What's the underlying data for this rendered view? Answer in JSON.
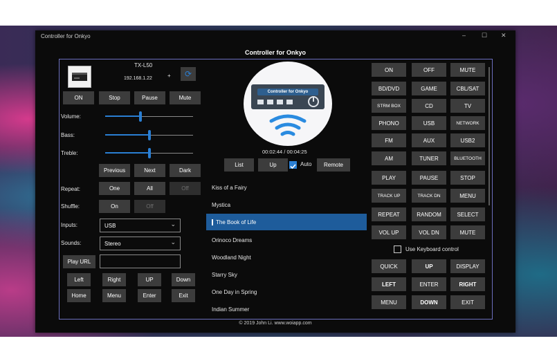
{
  "window": {
    "title": "Controller for Onkyo",
    "minimize": "–",
    "maximize": "☐",
    "close": "✕"
  },
  "app": {
    "title": "Controller for Onkyo",
    "footer": "© 2019 John Li. www.woiapp.com"
  },
  "device": {
    "model": "TX-L50",
    "ip": "192.168.1.22",
    "plus": "+"
  },
  "left": {
    "row1": [
      "ON",
      "Stop",
      "Pause",
      "Mute"
    ],
    "volume_label": "Volume:",
    "volume": 0.4,
    "bass_label": "Bass:",
    "bass": 0.5,
    "treble_label": "Treble:",
    "treble": 0.5,
    "nav": [
      "Previous",
      "Next",
      "Dark"
    ],
    "repeat_label": "Repeat:",
    "repeat": [
      "One",
      "All",
      "Off"
    ],
    "shuffle_label": "Shuffle:",
    "shuffle": [
      "On",
      "Off"
    ],
    "inputs_label": "Inputs:",
    "inputs_value": "USB",
    "sounds_label": "Sounds:",
    "sounds_value": "Stereo",
    "play_url": "Play URL",
    "url_value": "",
    "dir_row1": [
      "Left",
      "Right",
      "UP",
      "Down"
    ],
    "dir_row2": [
      "Home",
      "Menu",
      "Enter",
      "Exit"
    ]
  },
  "center": {
    "logo_text": "Controller for Onkyo",
    "time": "00:02:44 / 00:04:25",
    "list_btn": "List",
    "up_btn": "Up",
    "auto_label": "Auto",
    "remote_btn": "Remote",
    "songs": [
      "Kiss of a Fairy",
      "Mystica",
      "The Book of Life",
      "Orinoco Dreams",
      "Woodland Night",
      "Starry Sky",
      "One Day in Spring",
      "Indian Summer"
    ],
    "selected_song": "The Book of Life"
  },
  "right": {
    "rows": [
      [
        "ON",
        "OFF",
        "MUTE"
      ],
      [
        "BD/DVD",
        "GAME",
        "CBL/SAT"
      ],
      [
        "STRM BOX",
        "CD",
        "TV"
      ],
      [
        "PHONO",
        "USB",
        "NETWORK"
      ],
      [
        "FM",
        "AUX",
        "USB2"
      ],
      [
        "AM",
        "TUNER",
        "BLUETOOTH"
      ],
      [
        "PLAY",
        "PAUSE",
        "STOP"
      ],
      [
        "TRACK UP",
        "TRACK DN",
        "MENU"
      ],
      [
        "REPEAT",
        "RANDOM",
        "SELECT"
      ],
      [
        "VOL UP",
        "VOL DN",
        "MUTE"
      ]
    ],
    "keyboard_label": "Use Keyboard control",
    "nav_rows": [
      [
        "QUICK",
        "UP",
        "DISPLAY"
      ],
      [
        "LEFT",
        "ENTER",
        "RIGHT"
      ],
      [
        "MENU",
        "DOWN",
        "EXIT"
      ]
    ]
  },
  "colors": {
    "accent": "#2a7fd4",
    "panel_border": "#6c6fbf",
    "button": "#3c3c3c",
    "selected_row": "#1e5c9b"
  },
  "icons": {
    "device": "receiver-icon",
    "refresh": "refresh-icon",
    "logo": "onkyo-logo-icon"
  }
}
